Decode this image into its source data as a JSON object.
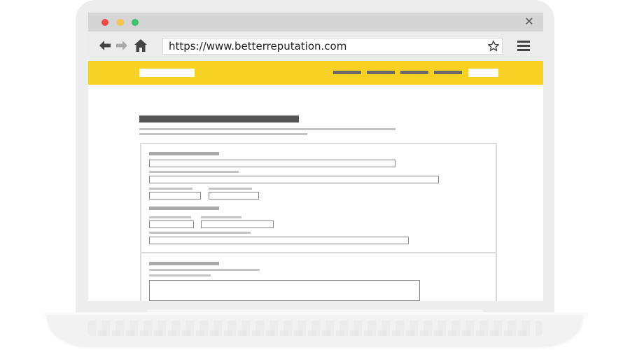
{
  "browser": {
    "url": "https://www.betterreputation.com",
    "window_controls": {
      "close_symbol": "✕"
    },
    "nav": {
      "back_symbol": "🡐",
      "forward_symbol": "🡒",
      "home_symbol": "⌂",
      "bookmark_symbol": "☆"
    }
  },
  "site": {
    "header": {
      "color": "#f7d123",
      "nav_item_count": 4
    }
  },
  "colors": {
    "accent": "#f7d123",
    "traffic_red": "#f04b4b",
    "traffic_yellow": "#f6c646",
    "traffic_green": "#3ec46d"
  }
}
